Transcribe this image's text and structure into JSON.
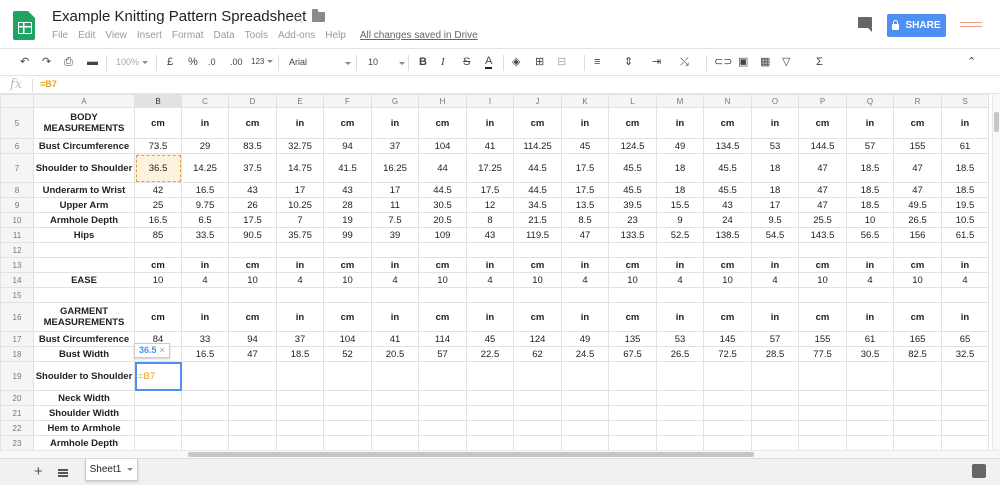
{
  "header": {
    "title": "Example Knitting Pattern Spreadsheet",
    "menus": [
      "File",
      "Edit",
      "View",
      "Insert",
      "Format",
      "Data",
      "Tools",
      "Add-ons",
      "Help"
    ],
    "saved_status": "All changes saved in Drive",
    "share_label": "SHARE"
  },
  "toolbar": {
    "zoom": "100%",
    "currency": "£",
    "percent": "%",
    "dec_decrease": ".0",
    "dec_increase": ".00",
    "more_formats": "123",
    "font": "Arial",
    "font_size": "10",
    "bold": "B",
    "italic": "I",
    "strike": "S",
    "text_color": "A",
    "sigma": "Σ"
  },
  "formula_bar": {
    "fx": "fx",
    "content": "=B7"
  },
  "grid": {
    "columns": [
      "A",
      "B",
      "C",
      "D",
      "E",
      "F",
      "G",
      "H",
      "I",
      "J",
      "K",
      "L",
      "M",
      "N",
      "O",
      "P",
      "Q",
      "R",
      "S"
    ],
    "rows": [
      {
        "num": "5",
        "cells": [
          "BODY MEASUREMENTS",
          "cm",
          "in",
          "cm",
          "in",
          "cm",
          "in",
          "cm",
          "in",
          "cm",
          "in",
          "cm",
          "in",
          "cm",
          "in",
          "cm",
          "in",
          "cm",
          "in"
        ]
      },
      {
        "num": "6",
        "cells": [
          "Bust Circumference",
          "73.5",
          "29",
          "83.5",
          "32.75",
          "94",
          "37",
          "104",
          "41",
          "114.25",
          "45",
          "124.5",
          "49",
          "134.5",
          "53",
          "144.5",
          "57",
          "155",
          "61"
        ]
      },
      {
        "num": "7",
        "cells": [
          "Shoulder to Shoulder",
          "36.5",
          "14.25",
          "37.5",
          "14.75",
          "41.5",
          "16.25",
          "44",
          "17.25",
          "44.5",
          "17.5",
          "45.5",
          "18",
          "45.5",
          "18",
          "47",
          "18.5",
          "47",
          "18.5"
        ]
      },
      {
        "num": "8",
        "cells": [
          "Underarm to Wrist",
          "42",
          "16.5",
          "43",
          "17",
          "43",
          "17",
          "44.5",
          "17.5",
          "44.5",
          "17.5",
          "45.5",
          "18",
          "45.5",
          "18",
          "47",
          "18.5",
          "47",
          "18.5"
        ]
      },
      {
        "num": "9",
        "cells": [
          "Upper Arm",
          "25",
          "9.75",
          "26",
          "10.25",
          "28",
          "11",
          "30.5",
          "12",
          "34.5",
          "13.5",
          "39.5",
          "15.5",
          "43",
          "17",
          "47",
          "18.5",
          "49.5",
          "19.5"
        ]
      },
      {
        "num": "10",
        "cells": [
          "Armhole Depth",
          "16.5",
          "6.5",
          "17.5",
          "7",
          "19",
          "7.5",
          "20.5",
          "8",
          "21.5",
          "8.5",
          "23",
          "9",
          "24",
          "9.5",
          "25.5",
          "10",
          "26.5",
          "10.5"
        ]
      },
      {
        "num": "11",
        "cells": [
          "Hips",
          "85",
          "33.5",
          "90.5",
          "35.75",
          "99",
          "39",
          "109",
          "43",
          "119.5",
          "47",
          "133.5",
          "52.5",
          "138.5",
          "54.5",
          "143.5",
          "56.5",
          "156",
          "61.5"
        ]
      },
      {
        "num": "12",
        "cells": [
          "",
          "",
          "",
          "",
          "",
          "",
          "",
          "",
          "",
          "",
          "",
          "",
          "",
          "",
          "",
          "",
          "",
          "",
          ""
        ]
      },
      {
        "num": "13",
        "cells": [
          "",
          "cm",
          "in",
          "cm",
          "in",
          "cm",
          "in",
          "cm",
          "in",
          "cm",
          "in",
          "cm",
          "in",
          "cm",
          "in",
          "cm",
          "in",
          "cm",
          "in"
        ]
      },
      {
        "num": "14",
        "cells": [
          "EASE",
          "10",
          "4",
          "10",
          "4",
          "10",
          "4",
          "10",
          "4",
          "10",
          "4",
          "10",
          "4",
          "10",
          "4",
          "10",
          "4",
          "10",
          "4"
        ]
      },
      {
        "num": "15",
        "cells": [
          "",
          "",
          "",
          "",
          "",
          "",
          "",
          "",
          "",
          "",
          "",
          "",
          "",
          "",
          "",
          "",
          "",
          "",
          ""
        ]
      },
      {
        "num": "16",
        "cells": [
          "GARMENT MEASUREMENTS",
          "cm",
          "in",
          "cm",
          "in",
          "cm",
          "in",
          "cm",
          "in",
          "cm",
          "in",
          "cm",
          "in",
          "cm",
          "in",
          "cm",
          "in",
          "cm",
          "in"
        ]
      },
      {
        "num": "17",
        "cells": [
          "Bust Circumference",
          "84",
          "33",
          "94",
          "37",
          "104",
          "41",
          "114",
          "45",
          "124",
          "49",
          "135",
          "53",
          "145",
          "57",
          "155",
          "61",
          "165",
          "65"
        ]
      },
      {
        "num": "18",
        "cells": [
          "Bust Width",
          "",
          "16.5",
          "47",
          "18.5",
          "52",
          "20.5",
          "57",
          "22.5",
          "62",
          "24.5",
          "67.5",
          "26.5",
          "72.5",
          "28.5",
          "77.5",
          "30.5",
          "82.5",
          "32.5"
        ]
      },
      {
        "num": "19",
        "cells": [
          "Shoulder to Shoulder",
          "=B7",
          "",
          "",
          "",
          "",
          "",
          "",
          "",
          "",
          "",
          "",
          "",
          "",
          "",
          "",
          "",
          "",
          ""
        ]
      },
      {
        "num": "20",
        "cells": [
          "Neck Width",
          "",
          "",
          "",
          "",
          "",
          "",
          "",
          "",
          "",
          "",
          "",
          "",
          "",
          "",
          "",
          "",
          "",
          ""
        ]
      },
      {
        "num": "21",
        "cells": [
          "Shoulder Width",
          "",
          "",
          "",
          "",
          "",
          "",
          "",
          "",
          "",
          "",
          "",
          "",
          "",
          "",
          "",
          "",
          "",
          ""
        ]
      },
      {
        "num": "22",
        "cells": [
          "Hem to Armhole",
          "",
          "",
          "",
          "",
          "",
          "",
          "",
          "",
          "",
          "",
          "",
          "",
          "",
          "",
          "",
          "",
          "",
          ""
        ]
      },
      {
        "num": "23",
        "cells": [
          "Armhole Depth",
          "",
          "",
          "",
          "",
          "",
          "",
          "",
          "",
          "",
          "",
          "",
          "",
          "",
          "",
          "",
          "",
          "",
          ""
        ]
      }
    ],
    "tooltip_value": "36.5",
    "tooltip_close": "×"
  },
  "sheets": {
    "add": "+",
    "tabs": [
      "Sheet1"
    ]
  },
  "colors": {
    "accent": "#4d8ff3",
    "sheets_green": "#1fa463",
    "formula_ref": "#e69e1c"
  }
}
